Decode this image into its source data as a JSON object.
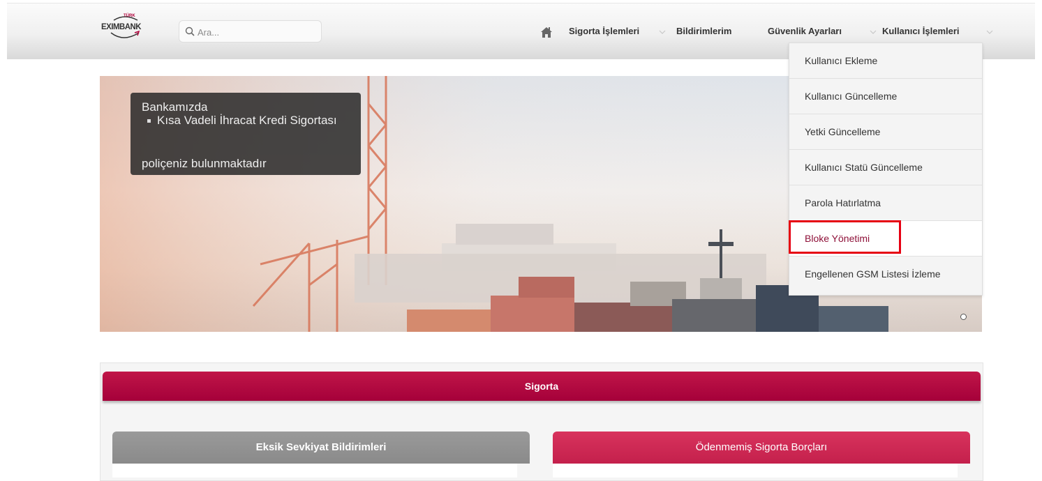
{
  "header": {
    "logo_small": "TÜRK",
    "logo_text": "EXIMBANK",
    "search_placeholder": "Ara...",
    "nav": {
      "sigorta": "Sigorta İşlemleri",
      "bildirimler": "Bildirimlerim",
      "guvenlik": "Güvenlik Ayarları",
      "kullanici": "Kullanıcı İşlemleri"
    }
  },
  "dropdown": {
    "items": [
      "Kullanıcı Ekleme",
      "Kullanıcı Güncelleme",
      "Yetki Güncelleme",
      "Kullanıcı Statü Güncelleme",
      "Parola Hatırlatma",
      "Bloke Yönetimi",
      "Engellenen GSM Listesi İzleme"
    ],
    "highlighted": "Bloke Yönetimi"
  },
  "banner": {
    "line1": "Bankamızda",
    "bullet": "Kısa Vadeli İhracat Kredi Sigortası",
    "line3": "poliçeniz bulunmaktadır"
  },
  "section": {
    "title": "Sigorta",
    "left_card": "Eksik Sevkiyat Bildirimleri",
    "right_card": "Ödenmemiş Sigorta Borçları"
  },
  "colors": {
    "brand": "#a5003a",
    "highlight_box": "#e60012",
    "card_grey": "#8e8e8e",
    "card_pink": "#d02a55"
  },
  "icons": [
    "search-icon",
    "home-icon",
    "chevron-down-icon"
  ]
}
